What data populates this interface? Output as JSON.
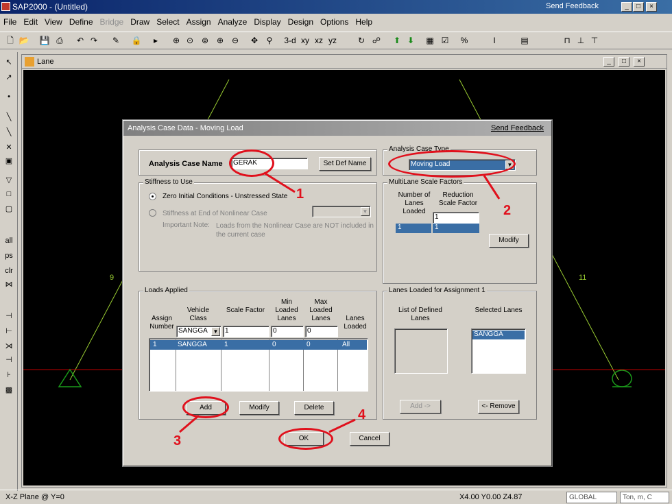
{
  "app": {
    "title": "SAP2000 - (Untitled)",
    "send_feedback": "Send Feedback"
  },
  "menu": [
    "File",
    "Edit",
    "View",
    "Define",
    "Bridge",
    "Draw",
    "Select",
    "Assign",
    "Analyze",
    "Display",
    "Design",
    "Options",
    "Help"
  ],
  "toolbar": {
    "view_labels": [
      "3-d",
      "xy",
      "xz",
      "yz"
    ]
  },
  "view": {
    "title": "Lane",
    "left_label": "9",
    "right_label": "11"
  },
  "dialog": {
    "title": "Analysis Case Data - Moving Load",
    "send_feedback": "Send Feedback",
    "case_name_label": "Analysis Case Name",
    "case_name_value": "GERAK",
    "set_def_name": "Set Def Name",
    "case_type_group": "Analysis Case Type",
    "case_type_value": "Moving Load",
    "stiffness_group": "Stiffness to Use",
    "stiffness_opt1": "Zero Initial Conditions - Unstressed State",
    "stiffness_opt2": "Stiffness at End of Nonlinear Case",
    "important_note_label": "Important Note:",
    "important_note_text": "Loads from the Nonlinear Case are NOT included in the current case",
    "multilane_group": "MultiLane Scale Factors",
    "multilane_headers": [
      "Number of Lanes Loaded",
      "Reduction Scale Factor"
    ],
    "multilane_input": "1",
    "multilane_row": [
      "1",
      "1"
    ],
    "multilane_modify": "Modify",
    "loads_group": "Loads Applied",
    "loads_headers": [
      "Assign Number",
      "Vehicle Class",
      "Scale Factor",
      "Min Loaded Lanes",
      "Max Loaded Lanes",
      "Lanes Loaded"
    ],
    "loads_inputs": {
      "vehicle": "SANGGA",
      "scale": "1",
      "min": "0",
      "max": "0"
    },
    "loads_row": [
      "1",
      "SANGGA",
      "1",
      "0",
      "0",
      "All"
    ],
    "add": "Add",
    "modify": "Modify",
    "delete": "Delete",
    "lanes_group": "Lanes Loaded for Assignment 1",
    "defined_lanes_header": "List of Defined Lanes",
    "selected_lanes_header": "Selected Lanes",
    "selected_lanes": [
      "SANGGA"
    ],
    "add_lane": "Add ->",
    "remove_lane": "<- Remove",
    "ok": "OK",
    "cancel": "Cancel"
  },
  "annotations": [
    "1",
    "2",
    "3",
    "4"
  ],
  "status": {
    "plane": "X-Z Plane @ Y=0",
    "coords": "X4.00  Y0.00  Z4.87",
    "coord_system": "GLOBAL",
    "units": "Ton, m, C"
  },
  "colors": {
    "annotation": "#e0101c",
    "selection": "#3a6ea5",
    "structure": "#9acd32",
    "beam": "#c00000"
  }
}
